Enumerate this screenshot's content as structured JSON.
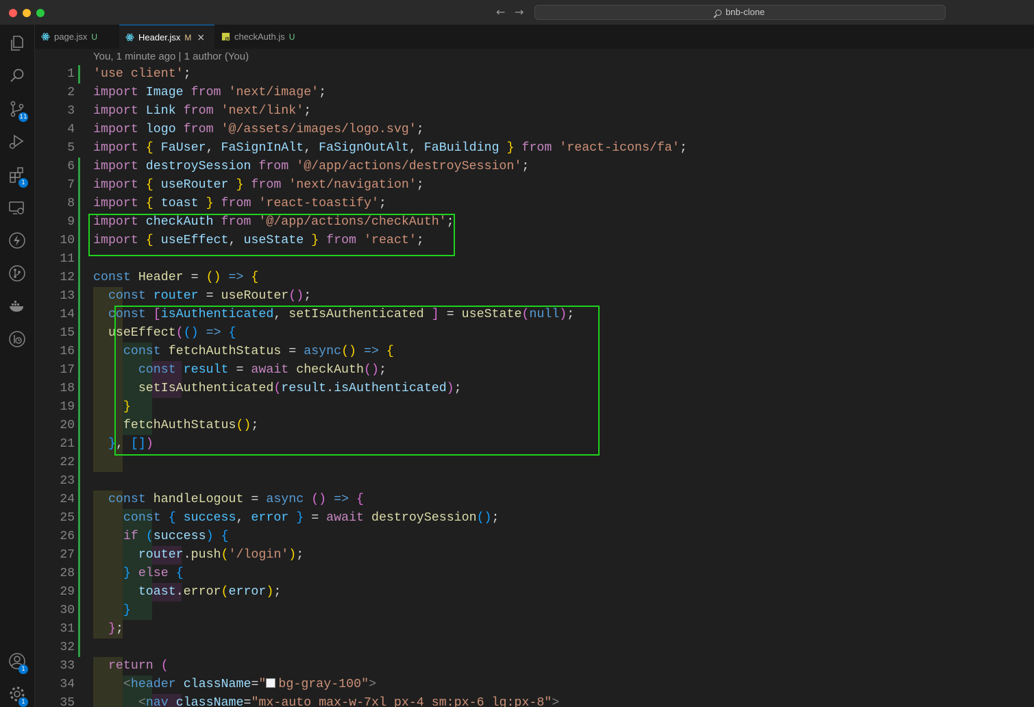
{
  "window": {
    "search_text": "bnb-clone"
  },
  "activity_bar": {
    "items": [
      {
        "name": "explorer-icon"
      },
      {
        "name": "search-icon"
      },
      {
        "name": "source-control-icon",
        "badge": "11"
      },
      {
        "name": "run-debug-icon"
      },
      {
        "name": "extensions-icon",
        "badge": "1"
      },
      {
        "name": "remote-explorer-icon"
      },
      {
        "name": "lightning-icon"
      },
      {
        "name": "git-graph-icon"
      },
      {
        "name": "docker-icon"
      },
      {
        "name": "timeline-icon"
      }
    ],
    "accounts_badge": "1",
    "settings_badge": "1"
  },
  "tabs": [
    {
      "label": "page.jsx",
      "status": "U",
      "active": false
    },
    {
      "label": "Header.jsx",
      "status": "M",
      "active": true,
      "close": "×"
    },
    {
      "label": "checkAuth.js",
      "status": "U",
      "active": false
    }
  ],
  "editor": {
    "codelens": "You, 1 minute ago | 1 author (You)",
    "lines": [
      [
        [
          "str",
          "'use client'"
        ],
        [
          "pu",
          ";"
        ]
      ],
      [
        [
          "ctl",
          "import "
        ],
        [
          "var",
          "Image"
        ],
        [
          "ctl",
          " from "
        ],
        [
          "str",
          "'next/image'"
        ],
        [
          "pu",
          ";"
        ]
      ],
      [
        [
          "ctl",
          "import "
        ],
        [
          "var",
          "Link"
        ],
        [
          "ctl",
          " from "
        ],
        [
          "str",
          "'next/link'"
        ],
        [
          "pu",
          ";"
        ]
      ],
      [
        [
          "ctl",
          "import "
        ],
        [
          "var",
          "logo"
        ],
        [
          "ctl",
          " from "
        ],
        [
          "str",
          "'@/assets/images/logo.svg'"
        ],
        [
          "pu",
          ";"
        ]
      ],
      [
        [
          "ctl",
          "import "
        ],
        [
          "b1",
          "{ "
        ],
        [
          "var",
          "FaUser"
        ],
        [
          "pu",
          ", "
        ],
        [
          "var",
          "FaSignInAlt"
        ],
        [
          "pu",
          ", "
        ],
        [
          "var",
          "FaSignOutAlt"
        ],
        [
          "pu",
          ", "
        ],
        [
          "var",
          "FaBuilding"
        ],
        [
          "b1",
          " }"
        ],
        [
          "ctl",
          " from "
        ],
        [
          "str",
          "'react-icons/fa'"
        ],
        [
          "pu",
          ";"
        ]
      ],
      [
        [
          "ctl",
          "import "
        ],
        [
          "var",
          "destroySession"
        ],
        [
          "ctl",
          " from "
        ],
        [
          "str",
          "'@/app/actions/destroySession'"
        ],
        [
          "pu",
          ";"
        ]
      ],
      [
        [
          "ctl",
          "import "
        ],
        [
          "b1",
          "{ "
        ],
        [
          "var",
          "useRouter"
        ],
        [
          "b1",
          " }"
        ],
        [
          "ctl",
          " from "
        ],
        [
          "str",
          "'next/navigation'"
        ],
        [
          "pu",
          ";"
        ]
      ],
      [
        [
          "ctl",
          "import "
        ],
        [
          "b1",
          "{ "
        ],
        [
          "var",
          "toast"
        ],
        [
          "b1",
          " }"
        ],
        [
          "ctl",
          " from "
        ],
        [
          "str",
          "'react-toastify'"
        ],
        [
          "pu",
          ";"
        ]
      ],
      [
        [
          "ctl",
          "import "
        ],
        [
          "var",
          "checkAuth"
        ],
        [
          "ctl",
          " from "
        ],
        [
          "str",
          "'@/app/actions/checkAuth'"
        ],
        [
          "pu",
          ";"
        ]
      ],
      [
        [
          "ctl",
          "import "
        ],
        [
          "b1",
          "{ "
        ],
        [
          "var",
          "useEffect"
        ],
        [
          "pu",
          ", "
        ],
        [
          "var",
          "useState"
        ],
        [
          "b1",
          " }"
        ],
        [
          "ctl",
          " from "
        ],
        [
          "str",
          "'react'"
        ],
        [
          "pu",
          ";"
        ]
      ],
      [],
      [
        [
          "kw",
          "const "
        ],
        [
          "fn",
          "Header"
        ],
        [
          "pu",
          " = "
        ],
        [
          "b1",
          "()"
        ],
        [
          "kw",
          " => "
        ],
        [
          "b1",
          "{"
        ]
      ],
      [
        [
          "pu",
          "  "
        ],
        [
          "kw",
          "const "
        ],
        [
          "cst",
          "router"
        ],
        [
          "pu",
          " = "
        ],
        [
          "fn",
          "useRouter"
        ],
        [
          "b2",
          "()"
        ],
        [
          "pu",
          ";"
        ]
      ],
      [
        [
          "pu",
          "  "
        ],
        [
          "kw",
          "const "
        ],
        [
          "b2",
          "["
        ],
        [
          "cst",
          "isAuthenticated"
        ],
        [
          "pu",
          ", "
        ],
        [
          "fn",
          "setIsAuthenticated"
        ],
        [
          "pu",
          " "
        ],
        [
          "b2",
          "]"
        ],
        [
          "pu",
          " = "
        ],
        [
          "fn",
          "useState"
        ],
        [
          "b2",
          "("
        ],
        [
          "kw",
          "null"
        ],
        [
          "b2",
          ")"
        ],
        [
          "pu",
          ";"
        ]
      ],
      [
        [
          "pu",
          "  "
        ],
        [
          "fn",
          "useEffect"
        ],
        [
          "b2",
          "("
        ],
        [
          "b3",
          "()"
        ],
        [
          "kw",
          " => "
        ],
        [
          "b3",
          "{"
        ]
      ],
      [
        [
          "pu",
          "    "
        ],
        [
          "kw",
          "const "
        ],
        [
          "fn",
          "fetchAuthStatus"
        ],
        [
          "pu",
          " = "
        ],
        [
          "kw",
          "async"
        ],
        [
          "b1",
          "()"
        ],
        [
          "kw",
          " => "
        ],
        [
          "b1",
          "{"
        ]
      ],
      [
        [
          "pu",
          "      "
        ],
        [
          "kw",
          "const "
        ],
        [
          "cst",
          "result"
        ],
        [
          "pu",
          " = "
        ],
        [
          "ctl",
          "await "
        ],
        [
          "fn",
          "checkAuth"
        ],
        [
          "b2",
          "()"
        ],
        [
          "pu",
          ";"
        ]
      ],
      [
        [
          "pu",
          "      "
        ],
        [
          "fn",
          "setIsAuthenticated"
        ],
        [
          "b2",
          "("
        ],
        [
          "var",
          "result"
        ],
        [
          "pu",
          "."
        ],
        [
          "var",
          "isAuthenticated"
        ],
        [
          "b2",
          ")"
        ],
        [
          "pu",
          ";"
        ]
      ],
      [
        [
          "pu",
          "    "
        ],
        [
          "b1",
          "}"
        ]
      ],
      [
        [
          "pu",
          "    "
        ],
        [
          "fn",
          "fetchAuthStatus"
        ],
        [
          "b1",
          "()"
        ],
        [
          "pu",
          ";"
        ]
      ],
      [
        [
          "pu",
          "  "
        ],
        [
          "b3",
          "}"
        ],
        [
          "pu",
          ", "
        ],
        [
          "b3",
          "[]"
        ],
        [
          "b2",
          ")"
        ]
      ],
      [],
      [],
      [
        [
          "pu",
          "  "
        ],
        [
          "kw",
          "const "
        ],
        [
          "fn",
          "handleLogout"
        ],
        [
          "pu",
          " = "
        ],
        [
          "kw",
          "async "
        ],
        [
          "b2",
          "()"
        ],
        [
          "kw",
          " => "
        ],
        [
          "b2",
          "{"
        ]
      ],
      [
        [
          "pu",
          "    "
        ],
        [
          "kw",
          "const "
        ],
        [
          "b3",
          "{ "
        ],
        [
          "cst",
          "success"
        ],
        [
          "pu",
          ", "
        ],
        [
          "cst",
          "error"
        ],
        [
          "b3",
          " }"
        ],
        [
          "pu",
          " = "
        ],
        [
          "ctl",
          "await "
        ],
        [
          "fn",
          "destroySession"
        ],
        [
          "b3",
          "()"
        ],
        [
          "pu",
          ";"
        ]
      ],
      [
        [
          "pu",
          "    "
        ],
        [
          "ctl",
          "if "
        ],
        [
          "b3",
          "("
        ],
        [
          "var",
          "success"
        ],
        [
          "b3",
          ")"
        ],
        [
          "pu",
          " "
        ],
        [
          "b3",
          "{"
        ]
      ],
      [
        [
          "pu",
          "      "
        ],
        [
          "var",
          "router"
        ],
        [
          "pu",
          "."
        ],
        [
          "fn",
          "push"
        ],
        [
          "b1",
          "("
        ],
        [
          "str",
          "'/login'"
        ],
        [
          "b1",
          ")"
        ],
        [
          "pu",
          ";"
        ]
      ],
      [
        [
          "pu",
          "    "
        ],
        [
          "b3",
          "}"
        ],
        [
          "ctl",
          " else "
        ],
        [
          "b3",
          "{"
        ]
      ],
      [
        [
          "pu",
          "      "
        ],
        [
          "var",
          "toast"
        ],
        [
          "pu",
          "."
        ],
        [
          "fn",
          "error"
        ],
        [
          "b1",
          "("
        ],
        [
          "var",
          "error"
        ],
        [
          "b1",
          ")"
        ],
        [
          "pu",
          ";"
        ]
      ],
      [
        [
          "pu",
          "    "
        ],
        [
          "b3",
          "}"
        ]
      ],
      [
        [
          "pu",
          "  "
        ],
        [
          "b2",
          "}"
        ],
        [
          "pu",
          ";"
        ]
      ],
      [],
      [
        [
          "pu",
          "  "
        ],
        [
          "ctl",
          "return "
        ],
        [
          "b2",
          "("
        ]
      ],
      [
        [
          "pu",
          "    "
        ],
        [
          "tagp",
          "<"
        ],
        [
          "tag",
          "header"
        ],
        [
          "pu",
          " "
        ],
        [
          "var",
          "className"
        ],
        [
          "pu",
          "="
        ],
        [
          "str",
          "\""
        ],
        [
          "swatch",
          "#f3f4f6"
        ],
        [
          "str",
          "bg-gray-100\""
        ],
        [
          "tagp",
          ">"
        ]
      ],
      [
        [
          "pu",
          "      "
        ],
        [
          "tagp",
          "<"
        ],
        [
          "tag",
          "nav"
        ],
        [
          "pu",
          " "
        ],
        [
          "var",
          "className"
        ],
        [
          "pu",
          "="
        ],
        [
          "str",
          "\"mx-auto max-w-7xl px-4 sm:px-6 lg:px-8\""
        ],
        [
          "tagp",
          ">"
        ]
      ]
    ],
    "line_numbers": [
      "1",
      "2",
      "3",
      "4",
      "5",
      "6",
      "7",
      "8",
      "9",
      "10",
      "11",
      "12",
      "13",
      "14",
      "15",
      "16",
      "17",
      "18",
      "19",
      "20",
      "21",
      "22",
      "23",
      "24",
      "25",
      "26",
      "27",
      "28",
      "29",
      "30",
      "31",
      "32",
      "33",
      "34",
      "35"
    ]
  }
}
